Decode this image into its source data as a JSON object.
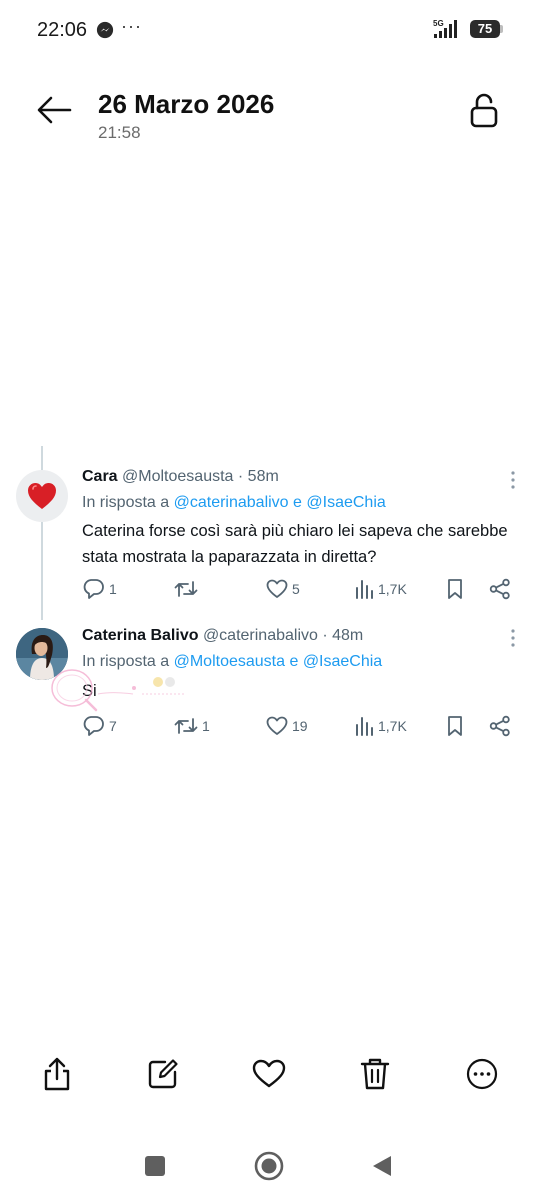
{
  "status_bar": {
    "time": "22:06",
    "messenger_icon": "messenger-icon",
    "more_indicator": "···",
    "network": "5G",
    "battery_level": "75"
  },
  "header": {
    "title": "26 Marzo 2026",
    "subtitle": "21:58",
    "back_icon": "arrow-left-icon",
    "lock_icon": "unlock-icon"
  },
  "tweets": [
    {
      "name": "Cara",
      "handle": "@Moltoesausta",
      "time": "· 58m",
      "reply_prefix": "In risposta a ",
      "reply_to_1": "@caterinabalivo",
      "reply_sep": " e ",
      "reply_to_2": "@IsaeChia",
      "text": "Caterina forse così sarà più chiaro lei sapeva che sarebbe stata mostrata la paparazzata in diretta?",
      "replies": "1",
      "retweets": "",
      "likes": "5",
      "views": "1,7K"
    },
    {
      "name": "Caterina Balivo",
      "handle": "@caterinabalivo",
      "time": "· 48m",
      "reply_prefix": "In risposta a ",
      "reply_to_1": "@Moltoesausta",
      "reply_sep": " e ",
      "reply_to_2": "@IsaeChia",
      "text": "Si",
      "replies": "7",
      "retweets": "1",
      "likes": "19",
      "views": "1,7K"
    }
  ],
  "toolbar": {
    "items": [
      "share-icon",
      "edit-icon",
      "heart-icon",
      "trash-icon",
      "more-circle-icon"
    ]
  },
  "nav": {
    "items": [
      "recents-square-icon",
      "home-circle-icon",
      "back-triangle-icon"
    ]
  },
  "colors": {
    "link": "#1d9bf0",
    "muted": "#536471",
    "text": "#0f1419"
  }
}
